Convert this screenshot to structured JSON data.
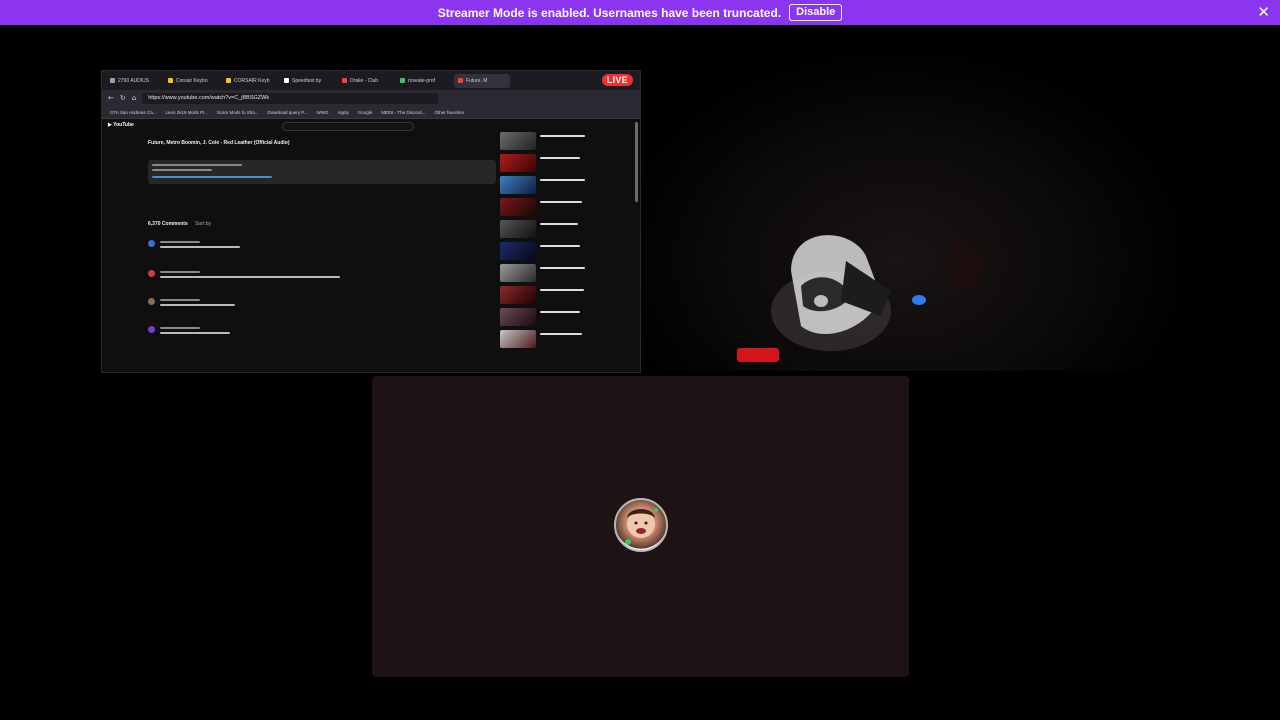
{
  "banner": {
    "message": "Streamer Mode is enabled. Usernames have been truncated.",
    "disable_label": "Disable",
    "close_glyph": "✕",
    "background": "#8b35ee"
  },
  "stream": {
    "live_label": "LIVE",
    "tabs": [
      "2790 AUDIUS",
      "Corsair Keybo",
      "CORSAIR Keyb",
      "Speedtest by",
      "Drake - Club",
      "roseate-prof",
      "Future, M"
    ],
    "url": "https://www.youtube.com/watch?v=C_jBBSGZWk",
    "bookmarks": [
      "GTA San Andreas Ca...",
      "Leon 2k19 Mods Pl...",
      "Scam Mods fo Sha...",
      "Download query P...",
      "WWG",
      "Apply",
      "Google",
      "MEE6 - The Discord...",
      "Other favorites"
    ],
    "youtube_logo": "▶ YouTube",
    "video_title": "Future, Metro Boomin, J. Cole - Red Leather (Official Audio)",
    "comments_count": "6,370 Comments",
    "sort_label": "Sort by"
  },
  "voice": {
    "avatar_name": "user-avatar"
  }
}
